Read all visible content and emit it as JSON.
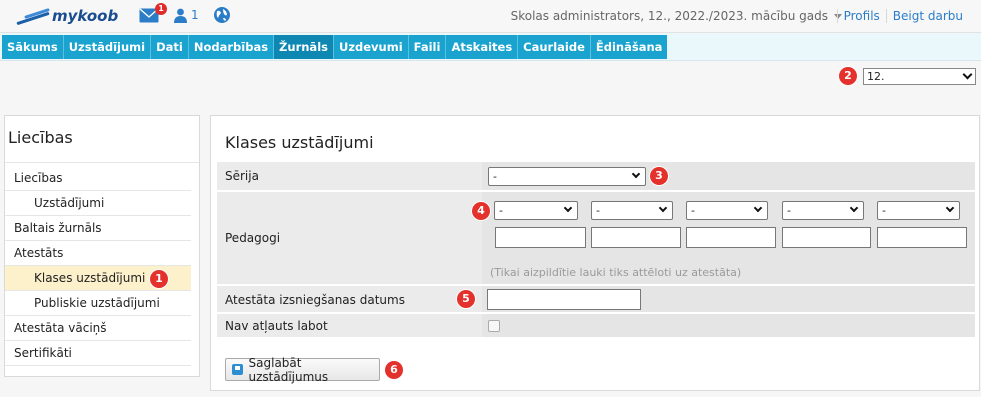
{
  "header": {
    "logo_text": "mykoob",
    "mail_count": "1",
    "users_count": "1",
    "user_info": "Skolas administrators, 12., 2022./2023. mācību gads",
    "links": [
      "Profils",
      "Beigt darbu"
    ]
  },
  "nav": {
    "items": [
      "Sākums",
      "Uzstādījumi",
      "Dati",
      "Nodarbības",
      "Žurnāls",
      "Uzdevumi",
      "Faili",
      "Atskaites",
      "Caurlaide",
      "Ēdināšana"
    ],
    "active_index": 4
  },
  "class_select": {
    "value": "12."
  },
  "markers": [
    "1",
    "2",
    "3",
    "4",
    "5",
    "6"
  ],
  "sidebar": {
    "title": "Liecības",
    "items": [
      {
        "label": "Liecības",
        "level": 0
      },
      {
        "label": "Uzstādījumi",
        "level": 1
      },
      {
        "label": "Baltais žurnāls",
        "level": 0
      },
      {
        "label": "Atestāts",
        "level": 0
      },
      {
        "label": "Klases uzstādījumi",
        "level": 1,
        "active": true
      },
      {
        "label": "Publiskie uzstādījumi",
        "level": 1
      },
      {
        "label": "Atestāta vāciņš",
        "level": 0
      },
      {
        "label": "Sertifikāti",
        "level": 0
      }
    ]
  },
  "main": {
    "title": "Klases uzstādījumi",
    "serija_label": "Sērija",
    "serija_value": "-",
    "pedagogi_label": "Pedagogi",
    "pedagogi_selects": [
      "-",
      "-",
      "-",
      "-",
      "-"
    ],
    "pedagogi_hint": "(Tikai aizpildītie lauki tiks attēloti uz atestāta)",
    "date_label": "Atestāta izsniegšanas datums",
    "date_value": "",
    "no_edit_label": "Nav atļauts labot",
    "no_edit_checked": false,
    "save_label": "Saglabāt uzstādījumus"
  },
  "colors": {
    "nav_bg": "#1aa3cf",
    "nav_active": "#0e88b3",
    "marker": "#e5312c",
    "sidebar_active": "#fdf1cc",
    "link": "#2b7dc8"
  }
}
